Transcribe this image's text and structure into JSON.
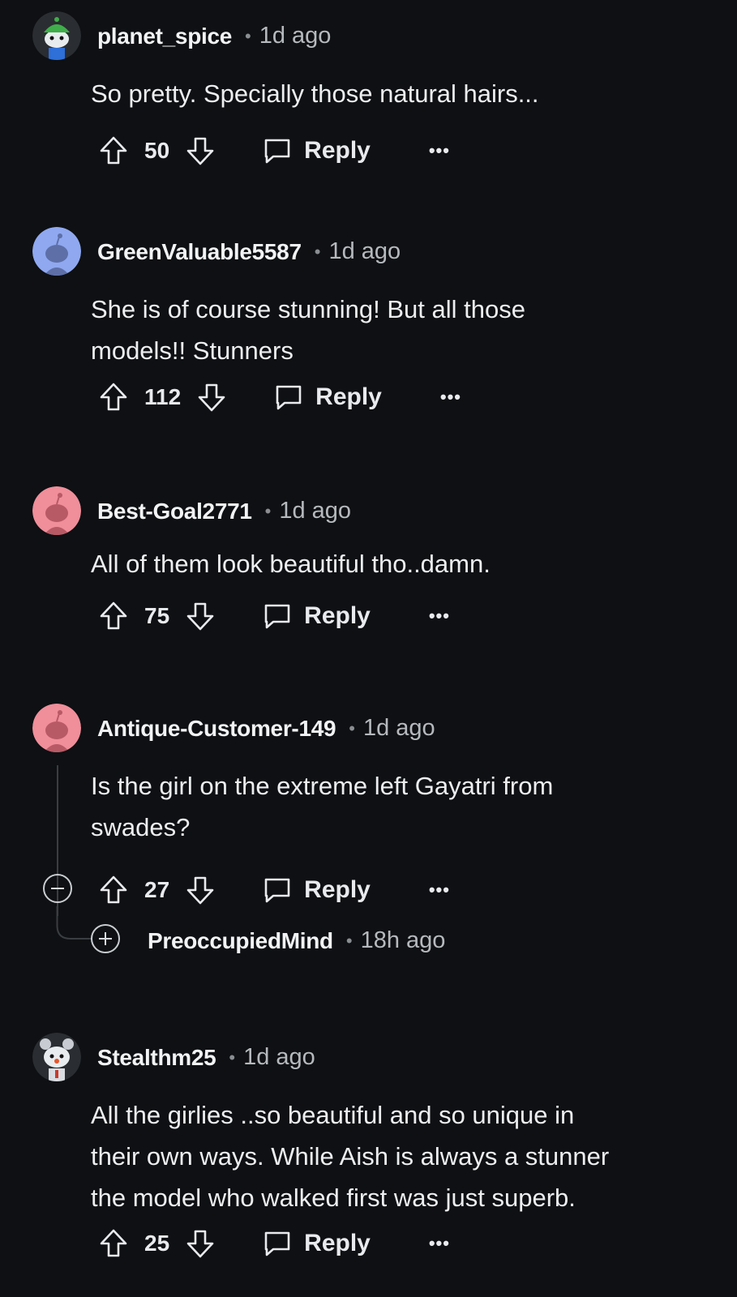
{
  "comments": [
    {
      "username": "planet_spice",
      "time": "1d ago",
      "lines": [
        "So pretty. Specially those natural hairs..."
      ],
      "score": "50",
      "reply_label": "Reply",
      "more": "•••",
      "avatar_color": "#2a2d31"
    },
    {
      "username": "GreenValuable5587",
      "time": "1d ago",
      "lines": [
        "She is of course stunning! But all those",
        "models!! Stunners"
      ],
      "score": "112",
      "reply_label": "Reply",
      "more": "•••",
      "avatar_color": "#8fa8f0"
    },
    {
      "username": "Best-Goal2771",
      "time": "1d ago",
      "lines": [
        "All of them look beautiful tho..damn."
      ],
      "score": "75",
      "reply_label": "Reply",
      "more": "•••",
      "avatar_color": "#f08e9a"
    },
    {
      "username": "Antique-Customer-149",
      "time": "1d ago",
      "lines": [
        "Is the girl on the extreme left Gayatri from",
        "swades?"
      ],
      "score": "27",
      "reply_label": "Reply",
      "more": "•••",
      "avatar_color": "#f08e9a",
      "collapsed_reply": {
        "username": "PreoccupiedMind",
        "time": "18h ago"
      }
    },
    {
      "username": "Stealthm25",
      "time": "1d ago",
      "lines": [
        "All the girlies ..so beautiful and so unique in",
        "their own ways. While Aish is always a stunner",
        "the model who walked first was just superb."
      ],
      "score": "25",
      "reply_label": "Reply",
      "more": "•••",
      "avatar_color": "#2a2d31"
    }
  ],
  "separator": "•"
}
